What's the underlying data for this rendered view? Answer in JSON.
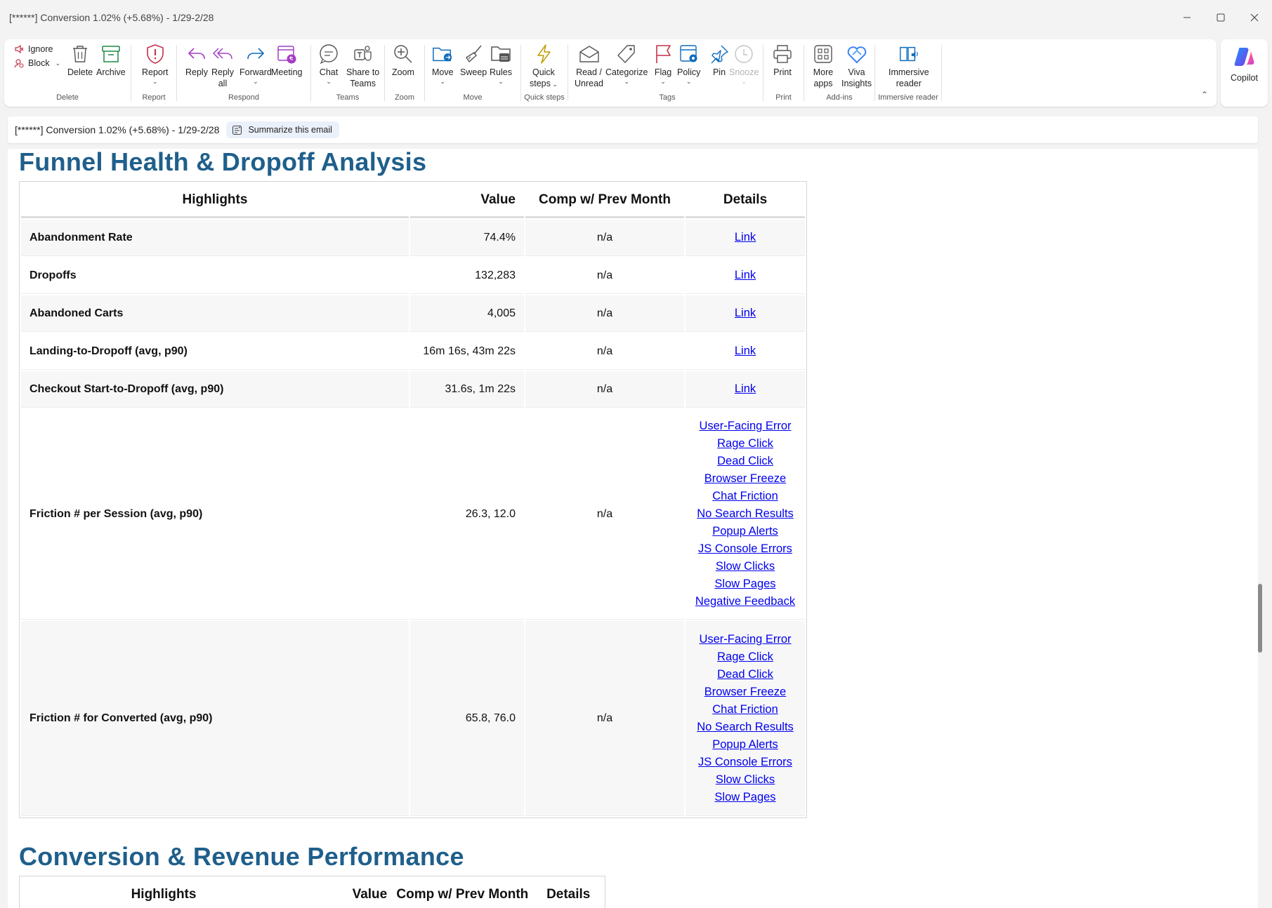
{
  "window": {
    "title": "[******] Conversion 1.02% (+5.68%) - 1/29-2/28"
  },
  "ribbon": {
    "delete_group": {
      "label": "Delete",
      "ignore": "Ignore",
      "block": "Block",
      "delete": "Delete",
      "archive": "Archive"
    },
    "report_group": {
      "label": "Report",
      "report": "Report"
    },
    "respond_group": {
      "label": "Respond",
      "reply": "Reply",
      "reply_all_1": "Reply",
      "reply_all_2": "all",
      "forward": "Forward",
      "meeting": "Meeting"
    },
    "teams_group": {
      "label": "Teams",
      "chat": "Chat",
      "share_1": "Share to",
      "share_2": "Teams"
    },
    "zoom_group": {
      "label": "Zoom",
      "zoom": "Zoom"
    },
    "move_group": {
      "label": "Move",
      "move": "Move",
      "sweep": "Sweep",
      "rules": "Rules"
    },
    "quicksteps_group": {
      "label": "Quick steps",
      "quick_1": "Quick",
      "quick_2": "steps"
    },
    "tags_group": {
      "label": "Tags",
      "read_1": "Read /",
      "read_2": "Unread",
      "categorize": "Categorize",
      "flag": "Flag",
      "policy": "Policy",
      "pin": "Pin",
      "snooze": "Snooze"
    },
    "print_group": {
      "label": "Print",
      "print": "Print"
    },
    "addins_group": {
      "label": "Add-ins",
      "more_1": "More",
      "more_2": "apps",
      "viva_1": "Viva",
      "viva_2": "Insights"
    },
    "immersive_group": {
      "label": "Immersive reader",
      "imm_1": "Immersive",
      "imm_2": "reader"
    },
    "copilot": "Copilot"
  },
  "subject_bar": {
    "subject": "[******] Conversion 1.02% (+5.68%) - 1/29-2/28",
    "summarize": "Summarize this email"
  },
  "section1": {
    "title": "Funnel Health & Dropoff Analysis",
    "headers": {
      "highlights": "Highlights",
      "value": "Value",
      "comp": "Comp w/ Prev Month",
      "details": "Details"
    },
    "rows": [
      {
        "highlight": "Abandonment Rate",
        "value": "74.4%",
        "comp": "n/a",
        "links": [
          "Link"
        ]
      },
      {
        "highlight": "Dropoffs",
        "value": "132,283",
        "comp": "n/a",
        "links": [
          "Link"
        ]
      },
      {
        "highlight": "Abandoned Carts",
        "value": "4,005",
        "comp": "n/a",
        "links": [
          "Link"
        ]
      },
      {
        "highlight": "Landing-to-Dropoff (avg, p90)",
        "value": "16m 16s, 43m 22s",
        "comp": "n/a",
        "links": [
          "Link"
        ]
      },
      {
        "highlight": "Checkout Start-to-Dropoff (avg, p90)",
        "value": "31.6s, 1m 22s",
        "comp": "n/a",
        "links": [
          "Link"
        ]
      },
      {
        "highlight": "Friction # per Session (avg, p90)",
        "value": "26.3, 12.0",
        "comp": "n/a",
        "links": [
          "User-Facing Error",
          "Rage Click",
          "Dead Click",
          "Browser Freeze",
          "Chat Friction",
          "No Search Results",
          "Popup Alerts",
          "JS Console Errors",
          "Slow Clicks",
          "Slow Pages",
          "Negative Feedback"
        ]
      },
      {
        "highlight": "Friction # for Converted (avg, p90)",
        "value": "65.8, 76.0",
        "comp": "n/a",
        "links": [
          "User-Facing Error",
          "Rage Click",
          "Dead Click",
          "Browser Freeze",
          "Chat Friction",
          "No Search Results",
          "Popup Alerts",
          "JS Console Errors",
          "Slow Clicks",
          "Slow Pages"
        ]
      }
    ]
  },
  "section2": {
    "title": "Conversion & Revenue Performance",
    "headers": {
      "highlights": "Highlights",
      "value": "Value",
      "comp": "Comp w/ Prev Month",
      "details": "Details"
    }
  },
  "colors": {
    "heading": "#1f5f8b",
    "link": "#0000ee",
    "accent": "#0f6cbd"
  }
}
